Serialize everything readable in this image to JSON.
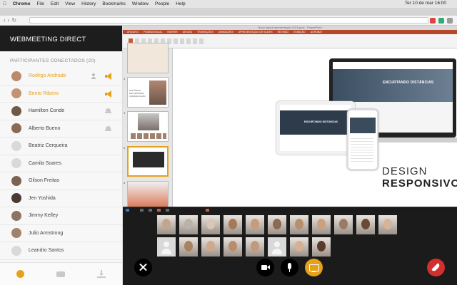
{
  "mac_menubar": {
    "app": "Chrome",
    "items": [
      "File",
      "Edit",
      "View",
      "History",
      "Bookmarks",
      "Window",
      "People",
      "Help"
    ],
    "clock": "Ter 10 de mar  16:00"
  },
  "sidebar": {
    "title": "WEBMEETING DIRECT",
    "participants_header": "PARTICIPANTES CONECTADOS (20)",
    "participants": [
      {
        "name": "Rodrigo Andrade",
        "presenter": true,
        "avatar_color": "#b98a6b",
        "icons": [
          "add-user-icon",
          "speaker-icon"
        ]
      },
      {
        "name": "Bento Ribeiro",
        "presenter": true,
        "avatar_color": "#c19372",
        "icons": [
          "speaker-icon"
        ]
      },
      {
        "name": "Hamilton Conde",
        "presenter": false,
        "avatar_color": "#6f5a4a",
        "icons": [
          "raise-hand-icon"
        ]
      },
      {
        "name": "Alberto Bueno",
        "presenter": false,
        "avatar_color": "#8a6a52",
        "icons": [
          "raise-hand-icon"
        ]
      },
      {
        "name": "Beatriz Cerqueira",
        "presenter": false,
        "avatar_color": "#d9d9d9",
        "icons": []
      },
      {
        "name": "Camila Soares",
        "presenter": false,
        "avatar_color": "#d9d9d9",
        "icons": []
      },
      {
        "name": "Gilson Freitas",
        "presenter": false,
        "avatar_color": "#7b6253",
        "icons": []
      },
      {
        "name": "Jen Yoshida",
        "presenter": false,
        "avatar_color": "#4b3a33",
        "icons": []
      },
      {
        "name": "Jimmy Kelley",
        "presenter": false,
        "avatar_color": "#8e7463",
        "icons": []
      },
      {
        "name": "Julio Armstrong",
        "presenter": false,
        "avatar_color": "#a0836c",
        "icons": []
      },
      {
        "name": "Leandro Santos",
        "presenter": false,
        "avatar_color": "#d9d9d9",
        "icons": []
      }
    ],
    "footer_icons": [
      "participants-icon",
      "chat-icon",
      "download-icon"
    ]
  },
  "presentation": {
    "window_title": "Novo layout apresentação 2015.pptx - PowerPoint",
    "ribbon_tabs": [
      "ARQUIVO",
      "PÁGINA INICIAL",
      "INSERIR",
      "DESIGN",
      "TRANSIÇÕES",
      "ANIMAÇÕES",
      "APRESENTAÇÃO DE SLIDES",
      "REVISÃO",
      "EXIBIÇÃO",
      "ACROBAT"
    ],
    "slide_numbers": [
      "3",
      "4",
      "5",
      "6",
      "7"
    ],
    "thumb_caption": "DISTÂNCIA ENCURTANDO COMUNICAÇÃO",
    "hero_text": "ENCURTANDO DISTÂNCIAS",
    "tablet_text": "ENCURTANDO DISTÂNCIAS",
    "slide_line1": "DESIGN",
    "slide_line2": "RESPONSIVO"
  },
  "video_tiles": [
    {
      "type": "face",
      "color": "#c4a58b"
    },
    {
      "type": "face",
      "color": "#b9b2ab"
    },
    {
      "type": "face",
      "color": "#d8c7b6"
    },
    {
      "type": "face",
      "color": "#a77857"
    },
    {
      "type": "face",
      "color": "#c89c7a"
    },
    {
      "type": "face",
      "color": "#8d6a50"
    },
    {
      "type": "face",
      "color": "#b98e6c"
    },
    {
      "type": "face",
      "color": "#caa07e"
    },
    {
      "type": "face",
      "color": "#9c7b62"
    },
    {
      "type": "face",
      "color": "#6b4a35"
    },
    {
      "type": "face",
      "color": "#d7b497"
    },
    {
      "type": "placeholder"
    },
    {
      "type": "face",
      "color": "#a9825f"
    },
    {
      "type": "face",
      "color": "#d1a98a"
    },
    {
      "type": "face",
      "color": "#ba8d6a"
    },
    {
      "type": "face",
      "color": "#c19a7c"
    },
    {
      "type": "placeholder"
    },
    {
      "type": "face",
      "color": "#d5b092"
    },
    {
      "type": "face",
      "color": "#5a3b29"
    }
  ],
  "controls": [
    "close-icon",
    "camera-icon",
    "microphone-icon",
    "share-screen-icon",
    "hang-up-icon"
  ],
  "colors": {
    "accent": "#e6a11a",
    "danger": "#d32f2f",
    "dark": "#1b1b1b"
  }
}
